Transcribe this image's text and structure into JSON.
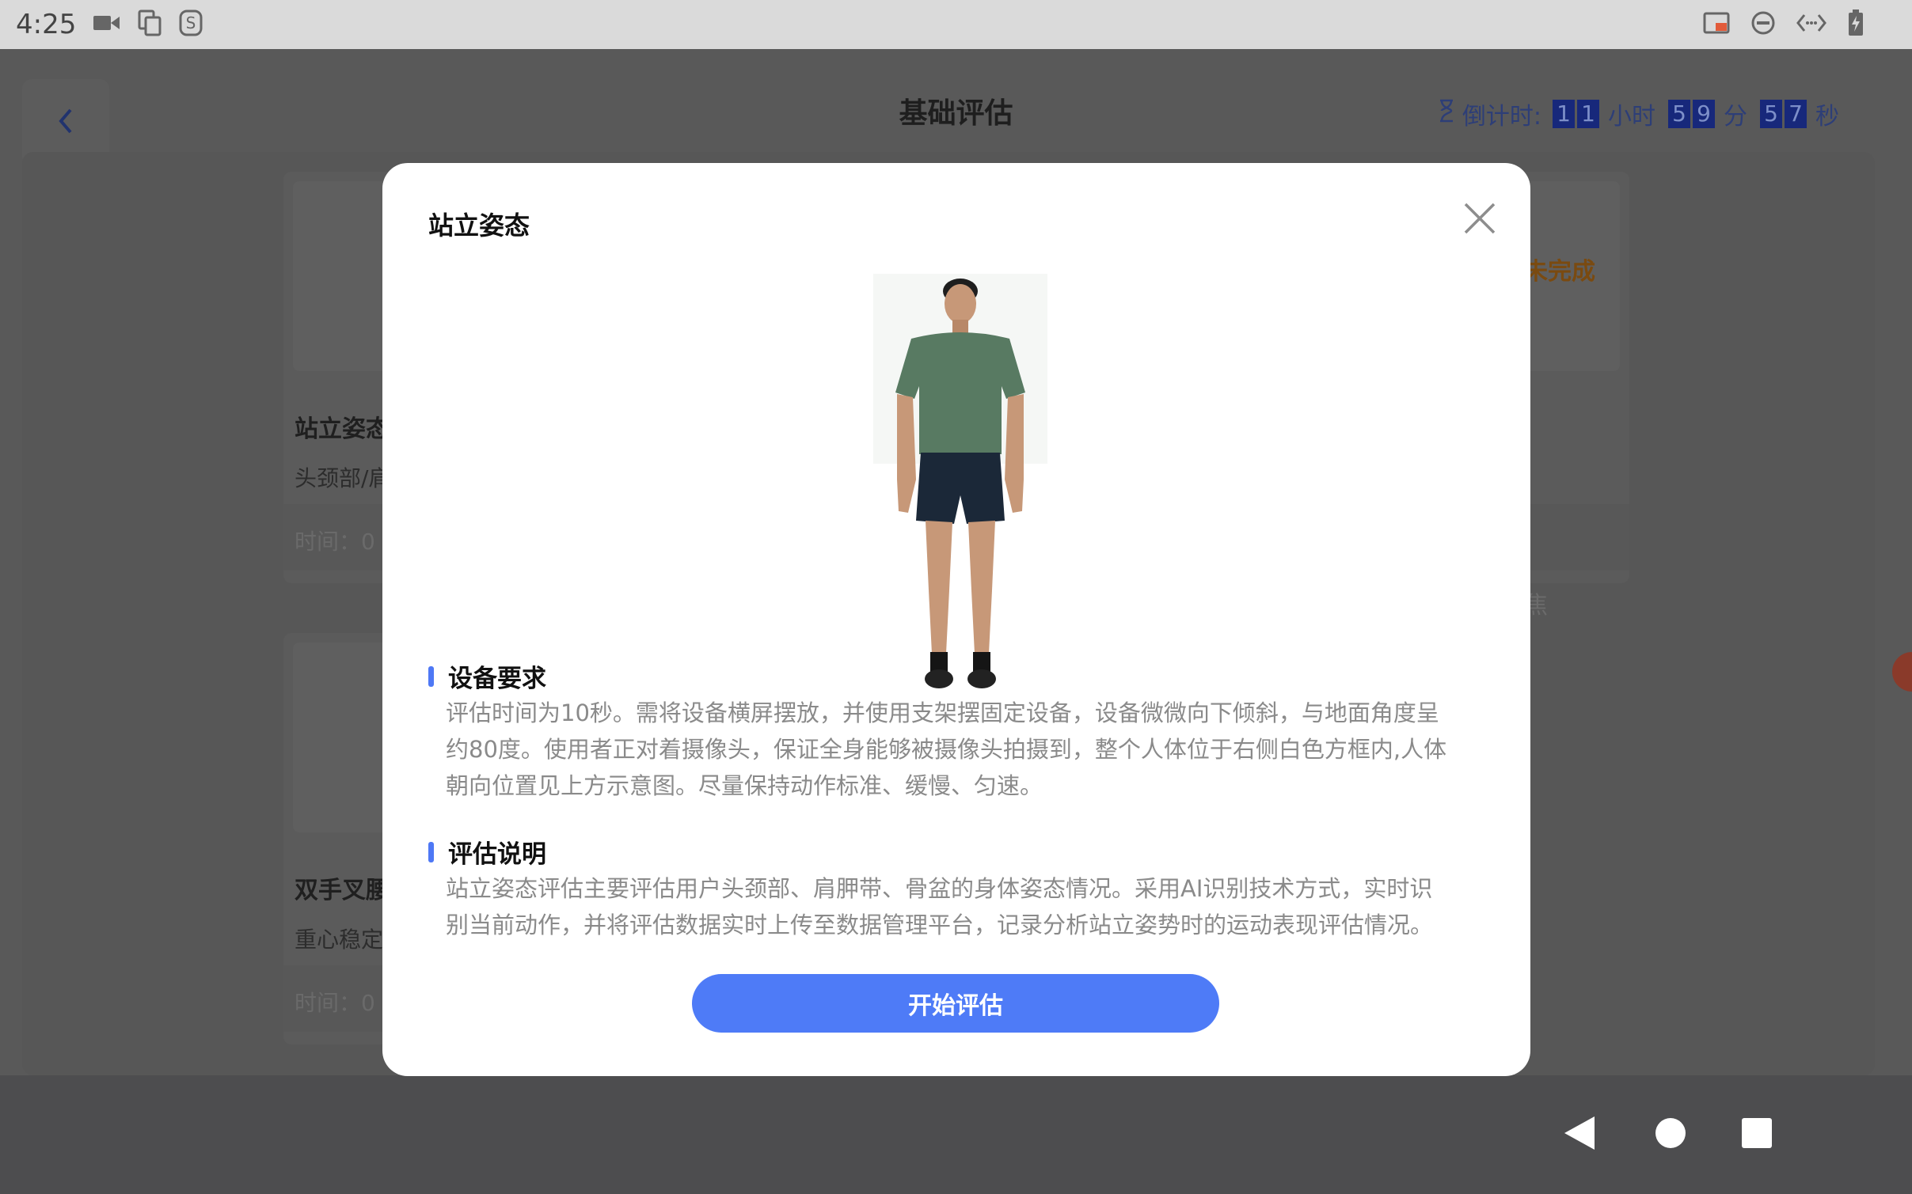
{
  "status_bar": {
    "time": "4:25",
    "left_icons": [
      "video-camera-icon",
      "copy-icon",
      "s-app-icon"
    ],
    "right_icons": [
      "cast-icon",
      "do-not-disturb-icon",
      "code-icon",
      "battery-charging-icon"
    ]
  },
  "header": {
    "back_icon": "chevron-left-icon",
    "title": "基础评估",
    "countdown": {
      "label": "倒计时:",
      "hours": [
        "1",
        "1"
      ],
      "hours_unit": "小时",
      "minutes": [
        "5",
        "9"
      ],
      "minutes_unit": "分",
      "seconds": [
        "5",
        "7"
      ],
      "seconds_unit": "秒"
    }
  },
  "background_cards": [
    {
      "name": "站立姿态",
      "sub": "头颈部/肩",
      "foot": "时间：0"
    },
    {
      "name": "双手叉腰",
      "sub": "重心稳定",
      "foot": "时间：0"
    }
  ],
  "background_right": {
    "status": "未完成",
    "foot": "焦"
  },
  "modal": {
    "title": "站立姿态",
    "close_icon": "close-icon",
    "figure_alt": "standing-person-figure",
    "sections": [
      {
        "heading": "设备要求",
        "lines": [
          "评估时间为10秒。需将设备横屏摆放，并使用支架摆固定设备，设备微微向下倾斜，与地面角度呈",
          "约80度。使用者正对着摄像头，保证全身能够被摄像头拍摄到，整个人体位于右侧白色方框内,人体",
          "朝向位置见上方示意图。尽量保持动作标准、缓慢、匀速。"
        ]
      },
      {
        "heading": "评估说明",
        "lines": [
          "站立姿态评估主要评估用户头颈部、肩胛带、骨盆的身体姿态情况。采用AI识别技术方式，实时识",
          "别当前动作，并将评估数据实时上传至数据管理平台，记录分析站立姿势时的运动表现评估情况。"
        ]
      }
    ],
    "start_button": "开始评估"
  },
  "nav_bar": {
    "icons": [
      "back-triangle-icon",
      "home-circle-icon",
      "recents-square-icon"
    ]
  },
  "colors": {
    "accent": "#4e7bf7",
    "overlay": "#595959",
    "modal_bg": "#ffffff"
  }
}
